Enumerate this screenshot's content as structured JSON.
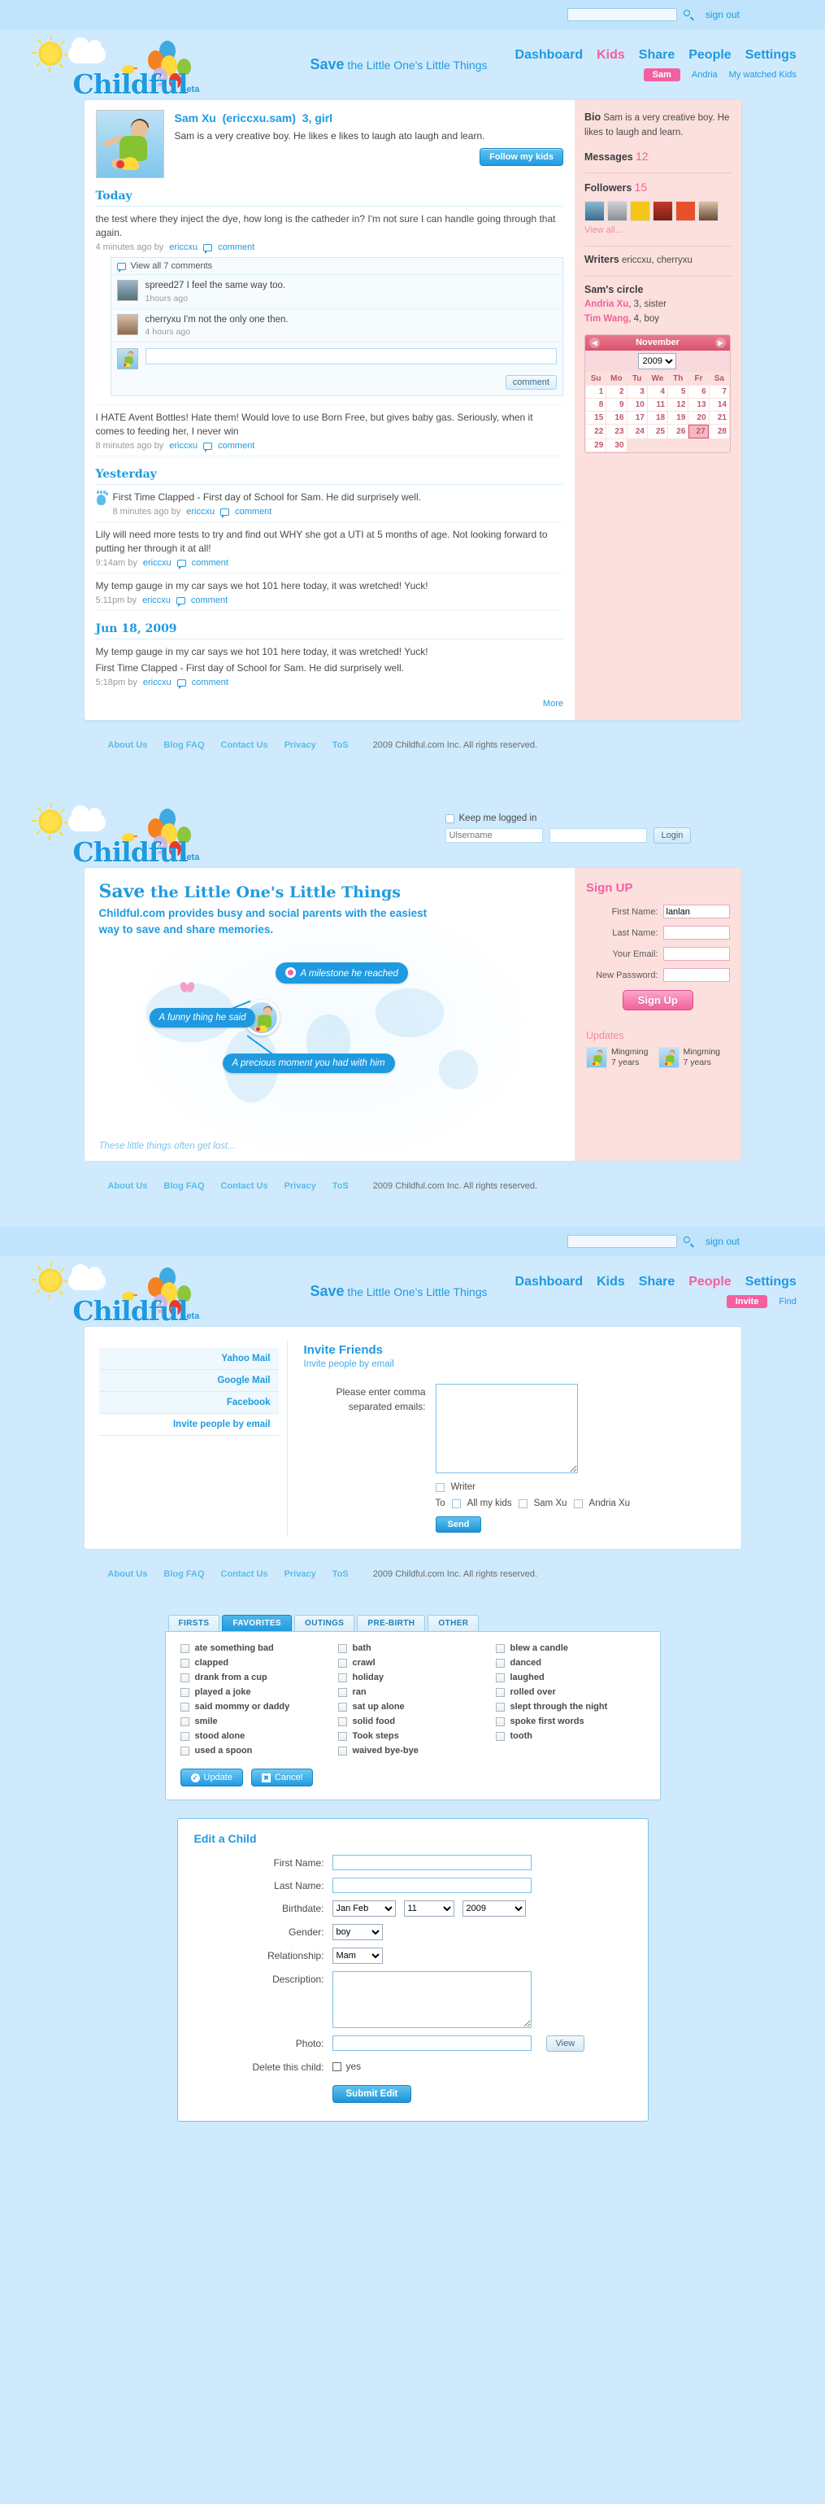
{
  "brand": {
    "name": "Childful",
    "beta": "Beta",
    "tagline_lead": "Save",
    "tagline_rest": " the Little One's Little Things"
  },
  "topbar": {
    "search_placeholder": "",
    "search_value": "",
    "signout_label": "sign out",
    "search_icon": "search-icon"
  },
  "nav": {
    "items": [
      {
        "label": "Dashboard",
        "active": false
      },
      {
        "label": "Kids",
        "active": true
      },
      {
        "label": "Share",
        "active": false
      },
      {
        "label": "People",
        "active": false
      },
      {
        "label": "Settings",
        "active": false
      }
    ],
    "sub_items": [
      {
        "label": "Sam",
        "active": true
      },
      {
        "label": "Andria",
        "active": false
      },
      {
        "label": "My watched Kids",
        "active": false
      }
    ]
  },
  "profile": {
    "name": "Sam Xu",
    "handle": "(ericcxu.sam)",
    "age_gender": "3, girl",
    "bio": "Sam is a very creative boy. He likes e likes to laugh ato laugh and learn.",
    "follow_button": "Follow my kids",
    "avatar_name": "child-photo-sam"
  },
  "feed": {
    "groups": [
      {
        "heading": "Today",
        "posts": [
          {
            "text": "the test where they inject the dye, how long is the catheder in? I'm not sure I can handle going through that again.",
            "time": "4 minutes ago by",
            "author": "ericcxu",
            "comment_label": "comment",
            "is_first": false,
            "comments": {
              "view_all": "View all 7 comments",
              "items": [
                {
                  "author": "spreed27",
                  "text": "I feel the same way too.",
                  "time": "1hours ago"
                },
                {
                  "author": "cherryxu",
                  "text": "I'm not the only one then.",
                  "time": "4 hours ago"
                }
              ],
              "input_value": "",
              "submit_label": "comment"
            }
          },
          {
            "text": "I HATE Avent Bottles! Hate them! Would love to use Born Free, but gives baby gas. Seriously, when it comes to feeding her, I never win",
            "time": "8 minutes ago by",
            "author": "ericcxu",
            "comment_label": "comment",
            "is_first": false
          }
        ]
      },
      {
        "heading": "Yesterday",
        "posts": [
          {
            "text": "First Time Clapped - First day of School for Sam. He did surprisely well.",
            "time": "8 minutes ago by",
            "author": "ericcxu",
            "comment_label": "comment",
            "is_first": true
          },
          {
            "text": "Lily will need more tests to try and find out WHY she got a UTI at 5 months of age. Not looking forward to putting her through it at all!",
            "time": "9:14am by",
            "author": "ericcxu",
            "comment_label": "comment",
            "is_first": false
          },
          {
            "text": "My temp gauge in my car says we hot 101 here today, it was wretched! Yuck!",
            "time": "5:11pm by",
            "author": "ericcxu",
            "comment_label": "comment",
            "is_first": false
          }
        ]
      },
      {
        "heading": "Jun 18, 2009",
        "posts": [
          {
            "text": "My temp gauge in my car says we hot 101 here today, it was wretched! Yuck!",
            "text2": "First Time Clapped - First day of School for Sam. He did surprisely well.",
            "time": "5:18pm  by",
            "author": "ericcxu",
            "comment_label": "comment",
            "is_first": false
          }
        ]
      }
    ],
    "more_label": "More"
  },
  "sidebar": {
    "bio_label": "Bio",
    "bio_text": "Sam is a very creative boy. He likes to laugh and learn.",
    "messages_label": "Messages",
    "messages_count": "12",
    "followers_label": "Followers",
    "followers_count": "15",
    "view_all": "View all...",
    "writers_label": "Writers",
    "writers_value": "ericcxu, cherryxu",
    "circle_label": "Sam's circle",
    "circle": [
      {
        "name": "Andria Xu",
        "detail": ", 3, sister"
      },
      {
        "name": "Tim Wang",
        "detail": ", 4, boy"
      }
    ],
    "calendar": {
      "month": "November",
      "year": "2009",
      "prev_icon": "chevron-left-icon",
      "next_icon": "chevron-right-icon",
      "weekdays": [
        "Su",
        "Mo",
        "Tu",
        "We",
        "Th",
        "Fr",
        "Sa"
      ],
      "start_offset": 0,
      "days_in_month": 30,
      "selected_day": 27
    }
  },
  "footer": {
    "links": [
      "About Us",
      "Blog FAQ",
      "Contact Us",
      "Privacy",
      "ToS"
    ],
    "copyright": "2009 Childful.com Inc. All rights reserved."
  },
  "landing": {
    "login": {
      "keep_label": "Keep me logged in",
      "keep_checked": false,
      "username_placeholder": "Ulsername",
      "username_value": "",
      "password_value": "",
      "login_button": "Login"
    },
    "hero": {
      "headline_strong": "Save",
      "headline_rest": " the Little One's Little Things",
      "sub": "Childful.com provides busy and social parents with the easiest way to save and share memories.",
      "bubbles": [
        "A milestone he reached",
        "A funny thing he said",
        "A precious moment you had with him"
      ],
      "note": "These little things often get lost..."
    },
    "signup": {
      "heading": "Sign UP",
      "fields": [
        {
          "label": "First Name:",
          "value": "lanlan"
        },
        {
          "label": "Last Name:",
          "value": ""
        },
        {
          "label": "Your Email:",
          "value": ""
        },
        {
          "label": "New Password:",
          "value": ""
        }
      ],
      "button": "Sign Up"
    },
    "updates": {
      "heading": "Updates",
      "items": [
        {
          "name": "Mingming",
          "age": "7 years"
        },
        {
          "name": "Mingming",
          "age": "7 years"
        }
      ]
    }
  },
  "invite_page": {
    "nav_sub": [
      {
        "label": "Invite",
        "active": true
      },
      {
        "label": "Find",
        "active": false
      }
    ],
    "tabs": [
      {
        "label": "Yahoo Mail",
        "active": false
      },
      {
        "label": "Google Mail",
        "active": false
      },
      {
        "label": "Facebook",
        "active": false
      },
      {
        "label": "Invite people by email",
        "active": true
      }
    ],
    "heading": "Invite Friends",
    "subheading": "Invite people by email",
    "field_label": "Please enter comma separated emails:",
    "textarea_value": "",
    "writer_label": "Writer",
    "to_label": "To",
    "to_options": [
      "All my kids",
      "Sam Xu",
      "Andria Xu"
    ],
    "send_button": "Send"
  },
  "firsts_panel": {
    "tabs": [
      {
        "label": "FIRSTS",
        "active": false
      },
      {
        "label": "FAVORITES",
        "active": true
      },
      {
        "label": "OUTINGS",
        "active": false
      },
      {
        "label": "PRE-BIRTH",
        "active": false
      },
      {
        "label": "OTHER",
        "active": false
      }
    ],
    "columns": [
      [
        "ate something bad",
        "clapped",
        "drank from a cup",
        "played a joke",
        "said mommy or daddy",
        "smile",
        "stood alone",
        "used a spoon"
      ],
      [
        "bath",
        "crawl",
        "holiday",
        "ran",
        "sat up alone",
        "solid food",
        "Took steps",
        "waived bye-bye"
      ],
      [
        "blew a candle",
        "danced",
        "laughed",
        "rolled over",
        "slept through the night",
        "spoke first words",
        "tooth"
      ]
    ],
    "update_button": "Update",
    "cancel_button": "Cancel"
  },
  "edit_child": {
    "heading": "Edit a Child",
    "first_name_label": "First Name:",
    "first_name_value": "",
    "last_name_label": "Last Name:",
    "last_name_value": "",
    "birthdate_label": "Birthdate:",
    "birth_month": "Jan Feb",
    "birth_day": "11",
    "birth_year": "2009",
    "gender_label": "Gender:",
    "gender_value": "boy",
    "relationship_label": "Relationship:",
    "relationship_value": "Mam",
    "description_label": "Description:",
    "description_value": "",
    "photo_label": "Photo:",
    "photo_value": "",
    "view_button": "View",
    "delete_label": "Delete this child:",
    "delete_yes": "yes",
    "submit_button": "Submit Edit"
  },
  "colors": {
    "accent_blue": "#1f9ae0",
    "accent_pink": "#f4609e",
    "page_bg": "#cfeafd",
    "sidebar_pink": "#fbe0de"
  }
}
